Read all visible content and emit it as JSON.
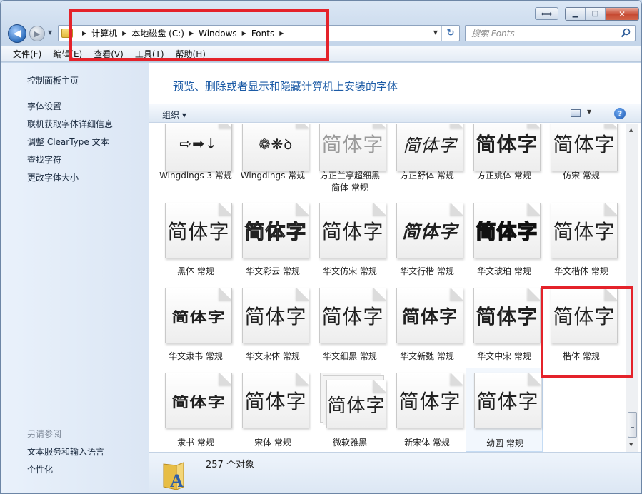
{
  "window": {
    "caption_extra": "⟺",
    "min_glyph": "▁",
    "max_glyph": "□",
    "close_glyph": "✕"
  },
  "nav": {
    "back": "◀",
    "forward": "▶",
    "dropdown": "▼",
    "breadcrumb": [
      "计算机",
      "本地磁盘 (C:)",
      "Windows",
      "Fonts"
    ],
    "separator": "▶",
    "refresh": "↻"
  },
  "search": {
    "placeholder": "搜索 Fonts"
  },
  "menu": [
    "文件(F)",
    "编辑(E)",
    "查看(V)",
    "工具(T)",
    "帮助(H)"
  ],
  "sidebar": {
    "items": [
      "控制面板主页",
      "字体设置",
      "联机获取字体详细信息",
      "调整 ClearType 文本",
      "查找字符",
      "更改字体大小"
    ],
    "see_also_heading": "另请参阅",
    "see_also": [
      "文本服务和输入语言",
      "个性化"
    ]
  },
  "main": {
    "title": "预览、删除或者显示和隐藏计算机上安装的字体",
    "organize": "组织 ▾",
    "view_dropdown": "▼",
    "help": "?"
  },
  "fonts": {
    "row1": [
      {
        "sample": "⇨➡↓",
        "name": "Wingdings 3 常规"
      },
      {
        "sample": "❁❋ꝺ",
        "name": "Wingdings 常规"
      },
      {
        "sample": "简体字",
        "name": "方正兰亭超细黑简体 常规"
      },
      {
        "sample": "简体字",
        "name": "方正舒体 常规"
      },
      {
        "sample": "简体字",
        "name": "方正姚体 常规"
      },
      {
        "sample": "简体字",
        "name": "仿宋 常规"
      }
    ],
    "row2": [
      {
        "sample": "简体字",
        "name": "黑体 常规"
      },
      {
        "sample": "简体字",
        "name": "华文彩云 常规"
      },
      {
        "sample": "简体字",
        "name": "华文仿宋 常规"
      },
      {
        "sample": "简体字",
        "name": "华文行楷 常规"
      },
      {
        "sample": "简体字",
        "name": "华文琥珀 常规"
      },
      {
        "sample": "简体字",
        "name": "华文楷体 常规"
      }
    ],
    "row3": [
      {
        "sample": "简体字",
        "name": "华文隶书 常规"
      },
      {
        "sample": "简体字",
        "name": "华文宋体 常规"
      },
      {
        "sample": "简体字",
        "name": "华文细黑 常规"
      },
      {
        "sample": "简体字",
        "name": "华文新魏 常规"
      },
      {
        "sample": "简体字",
        "name": "华文中宋 常规"
      },
      {
        "sample": "简体字",
        "name": "楷体 常规"
      }
    ],
    "row4": [
      {
        "sample": "简体字",
        "name": "隶书 常规"
      },
      {
        "sample": "简体字",
        "name": "宋体 常规"
      },
      {
        "sample": "简体字",
        "name": "微软雅黑"
      },
      {
        "sample": "简体字",
        "name": "新宋体 常规"
      },
      {
        "sample": "简体字",
        "name": "幼圆 常规"
      }
    ]
  },
  "details": {
    "count": "257 个对象"
  },
  "colors": {
    "highlight": "#e4222a",
    "title_blue": "#1c5ba6"
  }
}
